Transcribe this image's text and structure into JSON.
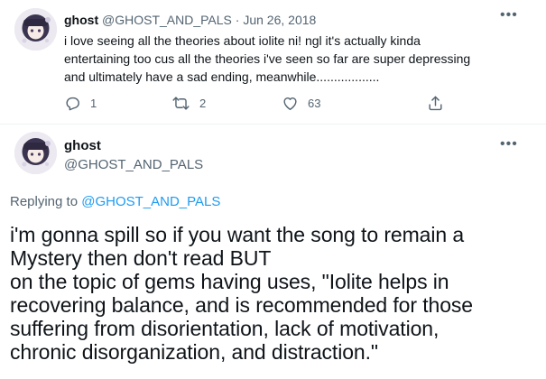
{
  "tweet1": {
    "name": "ghost",
    "handle": "@GHOST_AND_PALS",
    "separator": "·",
    "date": "Jun 26, 2018",
    "lines": [
      "i love seeing all the theories about iolite ni! ngl it's actually kinda",
      "entertaining too cus all the theories i've seen so far are super depressing",
      "and ultimately have a sad ending, meanwhile.................."
    ],
    "more": "•••",
    "reply_count": "1",
    "retweet_count": "2",
    "like_count": "63"
  },
  "tweet2": {
    "name": "ghost",
    "handle": "@GHOST_AND_PALS",
    "more": "•••",
    "replying_prefix": "Replying to",
    "replying_handle": "@GHOST_AND_PALS",
    "lines": [
      "i'm gonna spill so if you want the song to remain a",
      "Mystery then don't read BUT",
      "on the topic of gems having uses, \"Iolite helps in",
      "recovering balance, and is recommended for those",
      "suffering from disorientation, lack of motivation,",
      "chronic disorganization, and distraction.\""
    ]
  },
  "icons": {
    "reply": "reply-icon",
    "retweet": "retweet-icon",
    "like": "heart-icon",
    "share": "share-icon",
    "more": "more-icon"
  },
  "colors": {
    "text": "#0f1419",
    "muted": "#536471",
    "link": "#1d9bf0",
    "border": "#eff3f4"
  }
}
